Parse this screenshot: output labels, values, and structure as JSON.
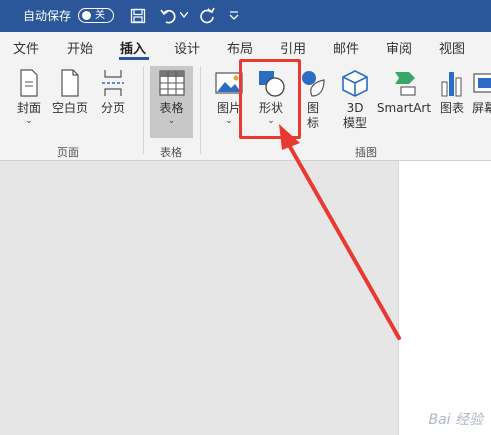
{
  "titlebar": {
    "autosave_label": "自动保存",
    "autosave_state": "关"
  },
  "menu": {
    "tabs": [
      "文件",
      "开始",
      "插入",
      "设计",
      "布局",
      "引用",
      "邮件",
      "审阅",
      "视图"
    ],
    "active_tab": "插入"
  },
  "ribbon": {
    "pages_group": {
      "label": "页面",
      "cover": "封面",
      "blank_page": "空白页",
      "page_break": "分页"
    },
    "table_group": {
      "label": "表格",
      "table": "表格"
    },
    "illustrations_group": {
      "label": "插图",
      "picture": "图片",
      "shapes": "形状",
      "icons_line1": "图",
      "icons_line2": "标",
      "model_line1": "3D",
      "model_line2": "模型",
      "smartart": "SmartArt",
      "chart": "图表",
      "screenshot": "屏幕"
    }
  },
  "watermark": "Bai 经验",
  "colors": {
    "titlebar": "#2b579a",
    "highlight": "#e83a33",
    "icon_blue": "#2b6cc4"
  }
}
